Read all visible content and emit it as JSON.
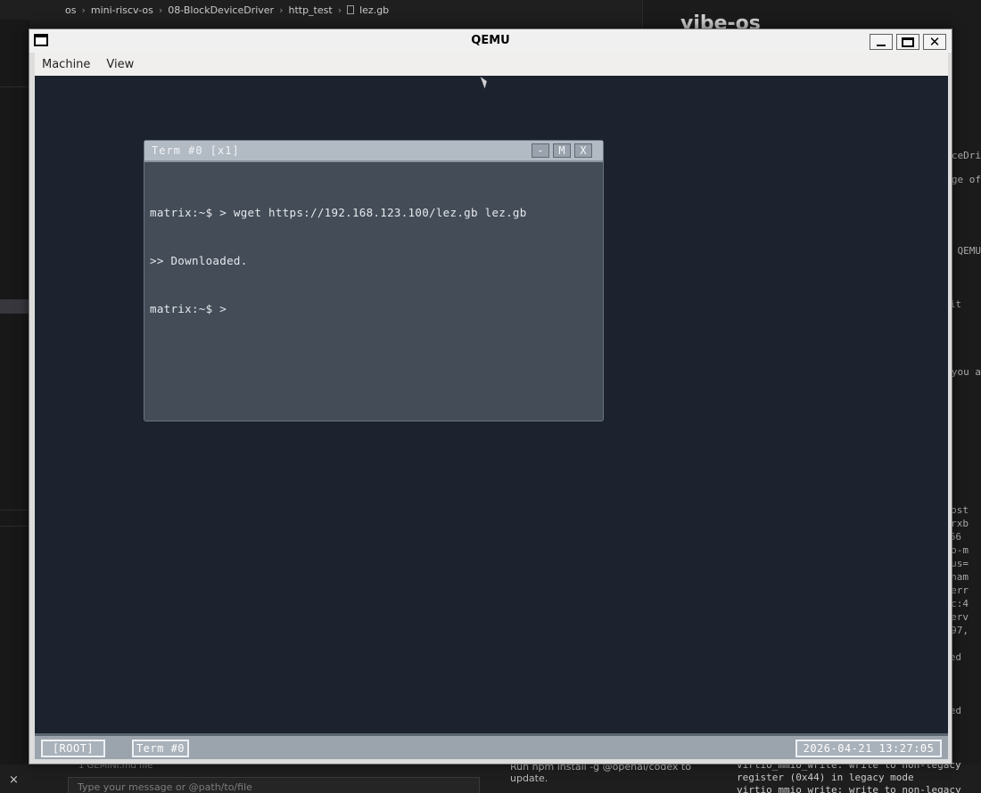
{
  "background_editor": {
    "breadcrumb": [
      "os",
      "mini-riscv-os",
      "08-BlockDeviceDriver",
      "http_test",
      "lez.gb"
    ],
    "right_title": "vibe-os",
    "right_fragments": [
      "ceDri",
      "ge of",
      "QEMU",
      "it",
      ", you a",
      "ost",
      "rxb",
      "66",
      "o-m",
      "us=",
      "nam",
      "err",
      "c:4",
      "erv",
      "97,",
      "ed",
      "ed"
    ],
    "bottom_file_label": "1 GEMINI.md file",
    "chat_placeholder": "Type your message or @path/to/file",
    "npm_text": "Run npm install -g @openai/codex to update.",
    "virtio_lines": [
      "virtio_mmio_write: write to non-legacy register (0x44) in legacy mode",
      "virtio_mmio_write: write to non-legacy regi"
    ],
    "close_glyph": "×"
  },
  "qemu": {
    "title": "QEMU",
    "menu": [
      "Machine",
      "View"
    ],
    "buttons": {
      "minimize": "_",
      "close": "✕"
    }
  },
  "guest": {
    "terminal": {
      "title": "Term #0 [x1]",
      "buttons": [
        "-",
        "M",
        "X"
      ],
      "lines": [
        "matrix:~$ > wget https://192.168.123.100/lez.gb lez.gb",
        ">> Downloaded.",
        "matrix:~$ >"
      ]
    },
    "taskbar": {
      "root_label": "[ROOT]",
      "term_label": "Term #0",
      "clock": "2026-04-21 13:27:05"
    }
  }
}
